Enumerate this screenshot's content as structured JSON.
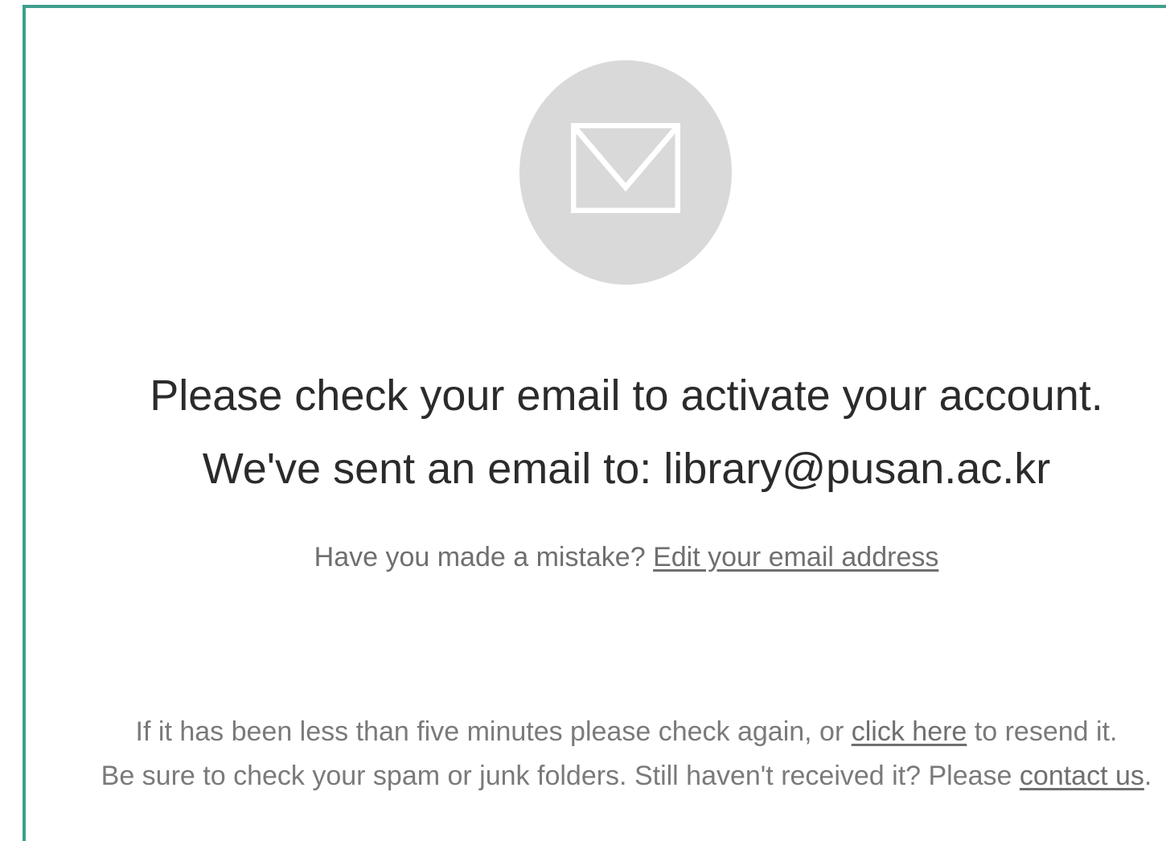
{
  "icon": {
    "name": "envelope-icon",
    "circle_color": "#d9d9d9",
    "glyph_color": "#ffffff"
  },
  "heading": {
    "line1": "Please check your email to activate your account.",
    "line2_prefix": "We've sent an email to: ",
    "email": "library@pusan.ac.kr"
  },
  "mistake": {
    "text": "Have you made a mistake? ",
    "link": "Edit your email address"
  },
  "footer": {
    "line1_before": "If it has been less than five minutes please check again, or ",
    "line1_link": "click here",
    "line1_after": " to resend it.",
    "line2_before": "Be sure to check your spam or junk folders. Still haven't received it? Please ",
    "line2_link": "contact us",
    "line2_after": "."
  },
  "colors": {
    "border": "#3f9e8d",
    "heading": "#2b2b2b",
    "muted": "#6f6f6f"
  }
}
